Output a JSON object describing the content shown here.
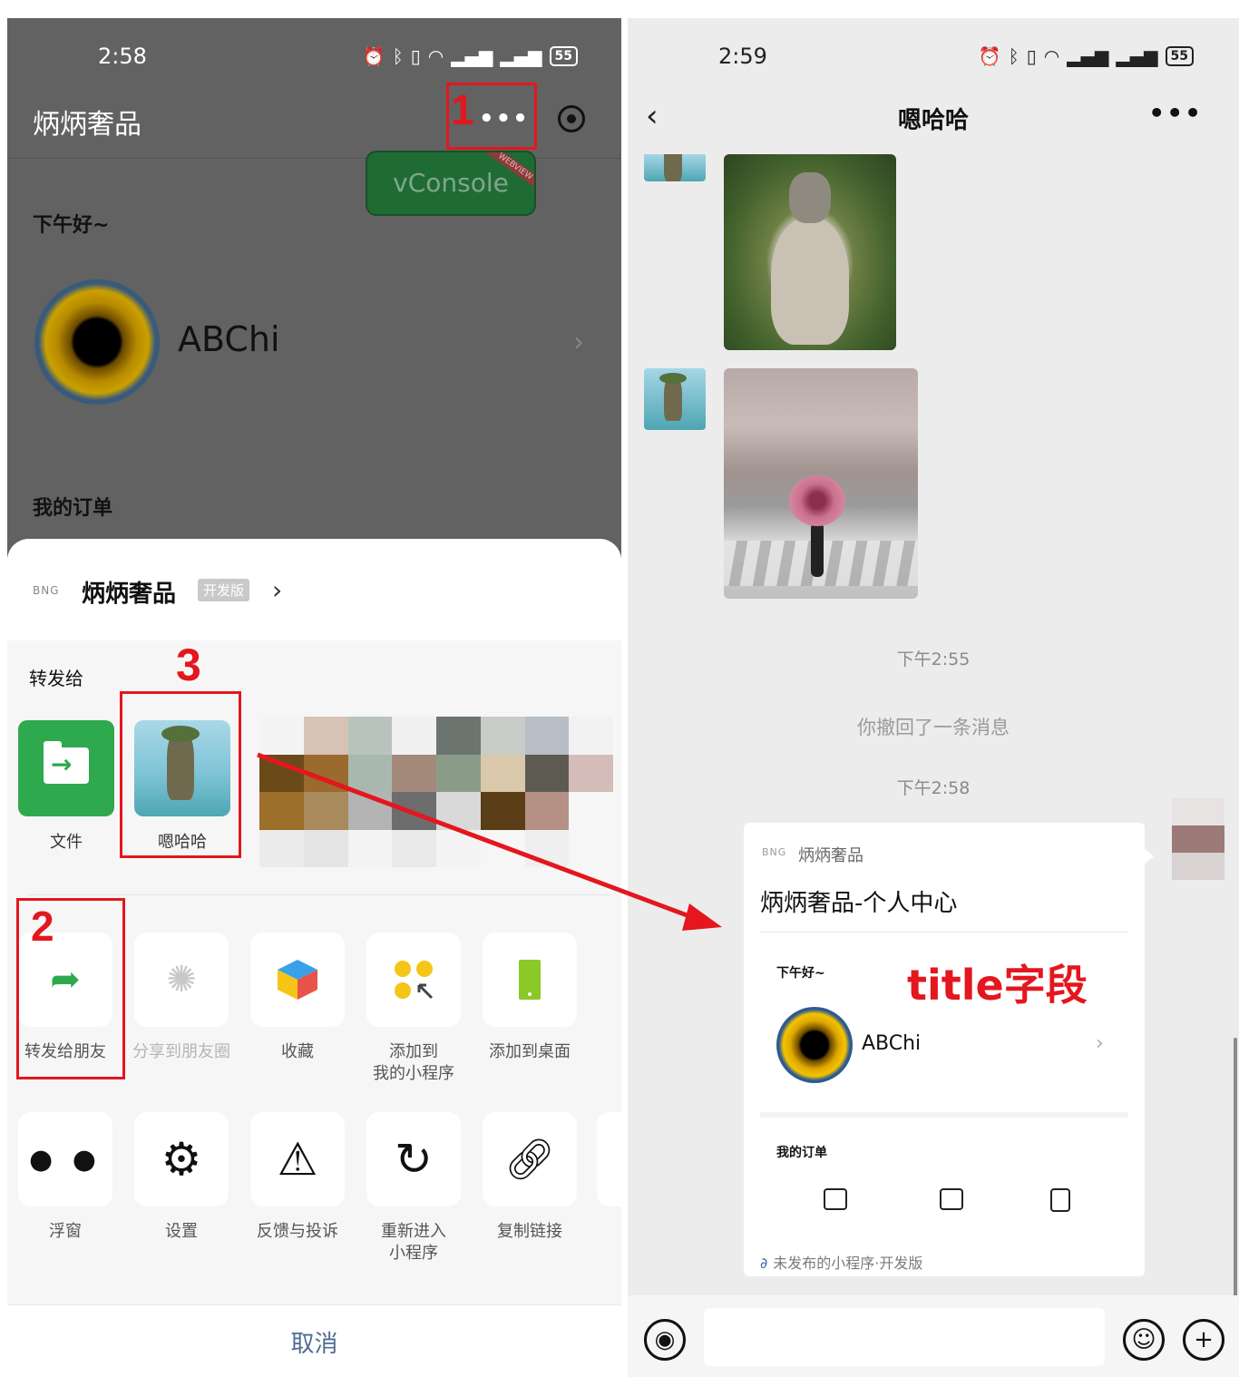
{
  "left": {
    "status_time": "2:58",
    "battery": "55",
    "page_title": "炳炳奢品",
    "vconsole": "vConsole",
    "vconsole_tag": "WEBVIEW",
    "greeting": "下午好~",
    "user_name": "ABChi",
    "orders_label": "我的订单",
    "sheet": {
      "brand": "BNG",
      "title": "炳炳奢品",
      "badge": "开发版",
      "forward_to": "转发给",
      "contacts": [
        {
          "name": "文件"
        },
        {
          "name": "嗯哈哈"
        }
      ],
      "actions_row1": [
        {
          "label": "转发给朋友",
          "icon": "forward-icon"
        },
        {
          "label": "分享到朋友圈",
          "icon": "moments-icon"
        },
        {
          "label": "收藏",
          "icon": "favorite-icon"
        },
        {
          "label": "添加到\n我的小程序",
          "icon": "add-mini-program-icon"
        },
        {
          "label": "添加到桌面",
          "icon": "add-desktop-icon"
        }
      ],
      "actions_row2": [
        {
          "label": "浮窗",
          "icon": "float-window-icon"
        },
        {
          "label": "设置",
          "icon": "gear-icon"
        },
        {
          "label": "反馈与投诉",
          "icon": "warning-icon"
        },
        {
          "label": "重新进入\n小程序",
          "icon": "reload-icon"
        },
        {
          "label": "复制链接",
          "icon": "link-icon"
        }
      ],
      "cancel": "取消"
    }
  },
  "annotations": {
    "step1": "1",
    "step2": "2",
    "step3": "3",
    "title_note": "title字段",
    "color": "#e4161e"
  },
  "right": {
    "status_time": "2:59",
    "battery": "55",
    "chat_title": "嗯哈哈",
    "time1": "下午2:55",
    "recall_msg": "你撤回了一条消息",
    "time2": "下午2:58",
    "card": {
      "brand": "BNG",
      "app_name": "炳炳奢品",
      "title": "炳炳奢品-个人中心",
      "preview_greeting": "下午好~",
      "preview_name": "ABChi",
      "preview_orders": "我的订单",
      "footer": "未发布的小程序·开发版"
    }
  },
  "colors": {
    "accent_green": "#2fa94d",
    "cancel_blue": "#506c93",
    "dim_overlay": "#626262"
  }
}
